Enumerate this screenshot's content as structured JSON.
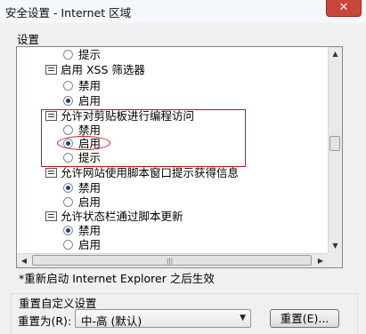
{
  "window": {
    "title": "安全设置 - Internet 区域",
    "close": "✕"
  },
  "settings": {
    "label": "设置",
    "rows": [
      {
        "kind": "option",
        "label": "提示",
        "checked": false
      },
      {
        "kind": "category",
        "label": "启用 XSS 筛选器"
      },
      {
        "kind": "option",
        "label": "禁用",
        "checked": false
      },
      {
        "kind": "option",
        "label": "启用",
        "checked": true
      },
      {
        "kind": "category",
        "label": "允许对剪贴板进行编程访问"
      },
      {
        "kind": "option",
        "label": "禁用",
        "checked": false
      },
      {
        "kind": "option",
        "label": "启用",
        "checked": true
      },
      {
        "kind": "option",
        "label": "提示",
        "checked": false
      },
      {
        "kind": "category",
        "label": "允许网站使用脚本窗口提示获得信息"
      },
      {
        "kind": "option",
        "label": "禁用",
        "checked": true
      },
      {
        "kind": "option",
        "label": "启用",
        "checked": false
      },
      {
        "kind": "category",
        "label": "允许状态栏通过脚本更新"
      },
      {
        "kind": "option",
        "label": "禁用",
        "checked": true
      },
      {
        "kind": "option",
        "label": "启用",
        "checked": false
      }
    ]
  },
  "restart_note": "*重新启动 Internet Explorer 之后生效",
  "reset": {
    "group_label": "重置自定义设置",
    "label": "重置为(R):",
    "dropdown_value": "中-高 (默认)",
    "button_label": "重置(E)..."
  },
  "colors": {
    "annotation": "#c01818",
    "radio_dot": "#1e3e74"
  }
}
